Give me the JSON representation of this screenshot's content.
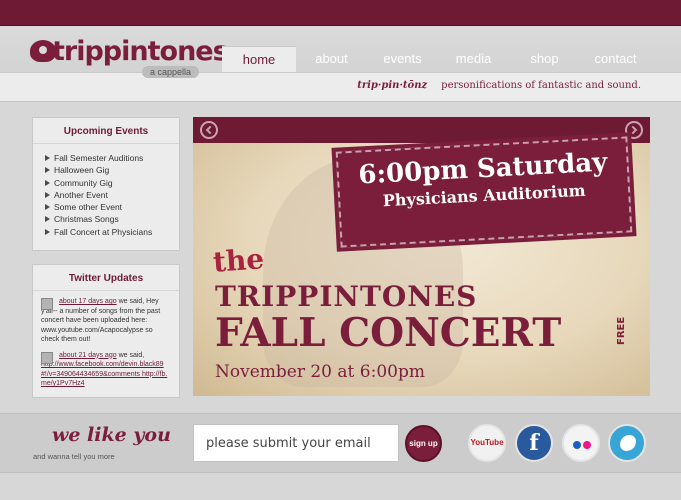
{
  "brand": {
    "name": "trippintones",
    "sub": "a cappella"
  },
  "nav": {
    "items": [
      {
        "label": "home",
        "active": true
      },
      {
        "label": "about"
      },
      {
        "label": "events"
      },
      {
        "label": "media"
      },
      {
        "label": "shop"
      },
      {
        "label": "contact"
      }
    ]
  },
  "tagline": {
    "pronunciation": "trip·pin·tōnz",
    "text": "personifications of fantastic and sound."
  },
  "events": {
    "title": "Upcoming Events",
    "items": [
      "Fall Semester Auditions",
      "Halloween Gig",
      "Community Gig",
      "Another Event",
      "Some other Event",
      "Christmas Songs",
      "Fall Concert at Physicians"
    ]
  },
  "twitter": {
    "title": "Twitter Updates",
    "tweets": [
      {
        "time": "about 17 days ago",
        "text": "we said, Hey y'all-- a number of songs from the past concert have been uploaded here: www.youtube.com/Acapocalypse so check them out!"
      },
      {
        "time": "about 21 days ago",
        "text": "we said,",
        "link": "http://www.facebook.com/devin.black89#!/v=349064434659&comments http://fb.me/y1Pv7Hz4"
      }
    ]
  },
  "slider": {
    "ticket_time": "6:00pm Saturday",
    "ticket_place": "Physicians Auditorium",
    "the": "the",
    "name": "TRIPPINTONES",
    "title": "FALL CONCERT",
    "free": "FREE",
    "date": "November 20 at 6:00pm"
  },
  "footer": {
    "we_like": "we like you",
    "wanna": "and wanna tell you more",
    "email_placeholder": "please submit your email",
    "signup": "sign up",
    "social": [
      "YouTube",
      "facebook",
      "flickr",
      "twitter"
    ]
  },
  "colors": {
    "brand": "#7a1e3c",
    "topbar": "#6e1a35",
    "bg": "#d7d7d7"
  }
}
